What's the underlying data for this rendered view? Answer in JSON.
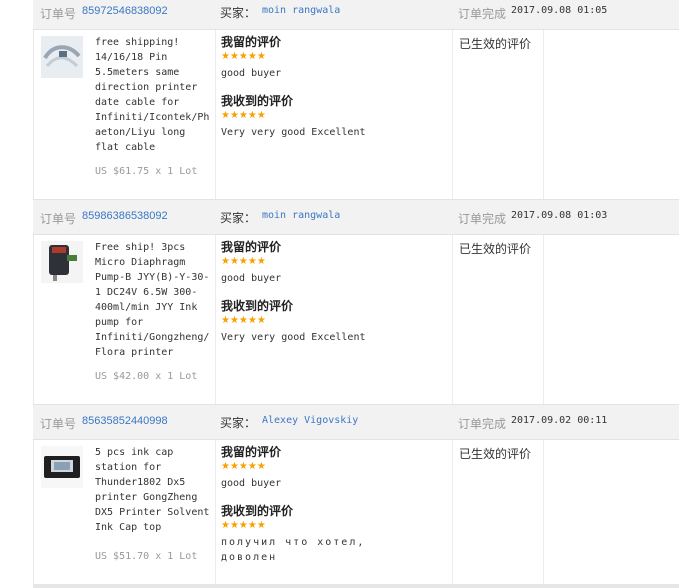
{
  "labels": {
    "order_no": "订单号",
    "buyer": "买家：",
    "completed": "订单完成",
    "my_review": "我留的评价",
    "received_review": "我收到的评价",
    "stars": "★★★★★",
    "status": "已生效的评价"
  },
  "orders": [
    {
      "order_no": "85972546838092",
      "buyer": "moin rangwala",
      "completed_time": "2017.09.08 01:05",
      "product_title": "free shipping!\n14/16/18 Pin\n5.5meters same\ndirection printer\ndate cable for\nInfiniti/Icontek/Ph\naeton/Liyu long\nflat cable",
      "price": "US $61.75 x 1 Lot",
      "my_review_text": "good buyer",
      "received_review_text": "Very very good Excellent",
      "my_rating": 5,
      "received_rating": 5,
      "thumb_icon": "flat-cable-product-icon"
    },
    {
      "order_no": "85986386538092",
      "buyer": "moin rangwala",
      "completed_time": "2017.09.08 01:03",
      "product_title": "Free ship! 3pcs\nMicro Diaphragm\nPump-B JYY(B)-Y-30-\n1 DC24V 6.5W 300-\n400ml/min JYY Ink\npump for\nInfiniti/Gongzheng/\nFlora printer",
      "price": "US $42.00 x 1 Lot",
      "my_review_text": "good buyer",
      "received_review_text": "Very very good Excellent",
      "my_rating": 5,
      "received_rating": 5,
      "thumb_icon": "ink-pump-product-icon"
    },
    {
      "order_no": "85635852440998",
      "buyer": "Alexey Vigovskiy",
      "completed_time": "2017.09.02 00:11",
      "product_title": "5 pcs ink cap\nstation for\nThunder1802 Dx5\nprinter GongZheng\nDX5 Printer Solvent\nInk Cap top",
      "price": "US $51.70 x 1 Lot",
      "my_review_text": "good buyer",
      "received_review_text": "получил что хотел,\nдоволен",
      "my_rating": 5,
      "received_rating": 5,
      "thumb_icon": "ink-cap-product-icon"
    }
  ],
  "colors": {
    "link": "#3a77c4",
    "star": "#f7a100",
    "header_bg": "#f2f2f2"
  }
}
